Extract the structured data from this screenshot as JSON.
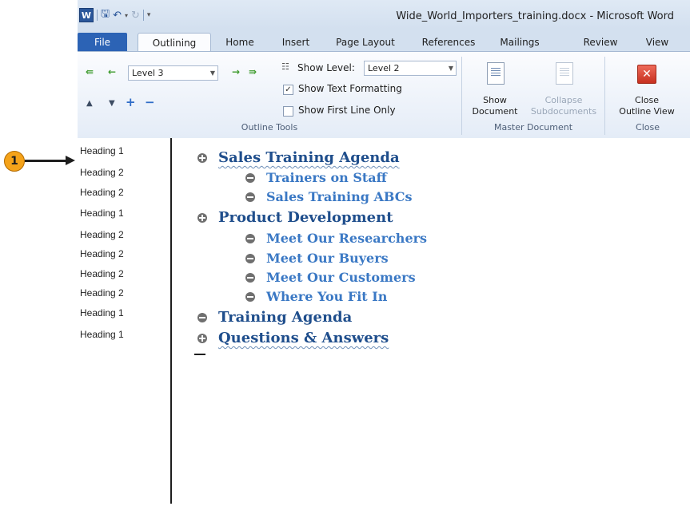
{
  "window": {
    "title": "Wide_World_Importers_training.docx - Microsoft Word",
    "app_icon": "W"
  },
  "quick_access": {
    "icons": [
      "save-icon",
      "undo-icon",
      "redo-icon",
      "customize-icon"
    ]
  },
  "tabs": [
    {
      "label": "File"
    },
    {
      "label": "Outlining"
    },
    {
      "label": "Home"
    },
    {
      "label": "Insert"
    },
    {
      "label": "Page Layout"
    },
    {
      "label": "References"
    },
    {
      "label": "Mailings"
    },
    {
      "label": "Review"
    },
    {
      "label": "View"
    }
  ],
  "ribbon": {
    "outline_tools": {
      "level_value": "Level 3",
      "show_level_label": "Show Level:",
      "show_level_value": "Level 2",
      "show_text_formatting_label": "Show Text Formatting",
      "show_text_formatting_checked": true,
      "show_first_line_only_label": "Show First Line Only",
      "show_first_line_only_checked": false,
      "group_label": "Outline Tools"
    },
    "master_document": {
      "show_document_label_1": "Show",
      "show_document_label_2": "Document",
      "collapse_label_1": "Collapse",
      "collapse_label_2": "Subdocuments",
      "group_label": "Master Document"
    },
    "close": {
      "close_label_1": "Close",
      "close_label_2": "Outline View",
      "group_label": "Close"
    }
  },
  "style_area": [
    "Heading 1",
    "Heading 2",
    "Heading 2",
    "Heading 1",
    "Heading 2",
    "Heading 2",
    "Heading 2",
    "Heading 2",
    "Heading 1",
    "Heading 1"
  ],
  "outline": [
    {
      "text": "Sales Training Agenda",
      "level": 1,
      "symbol": "plus"
    },
    {
      "text": "Trainers on Staff",
      "level": 2,
      "symbol": "minus"
    },
    {
      "text": "Sales Training ABCs",
      "level": 2,
      "symbol": "minus"
    },
    {
      "text": "Product Development",
      "level": 1,
      "symbol": "plus"
    },
    {
      "text": "Meet Our Researchers",
      "level": 2,
      "symbol": "minus"
    },
    {
      "text": "Meet Our Buyers",
      "level": 2,
      "symbol": "minus"
    },
    {
      "text": "Meet Our Customers",
      "level": 2,
      "symbol": "minus"
    },
    {
      "text": "Where You Fit In",
      "level": 2,
      "symbol": "minus"
    },
    {
      "text": "Training Agenda",
      "level": 1,
      "symbol": "minus"
    },
    {
      "text": "Questions & Answers",
      "level": 1,
      "symbol": "plus"
    }
  ],
  "callout": {
    "number": "1"
  },
  "colors": {
    "heading1": "#1f4e8c",
    "heading2": "#3a78c4",
    "file_tab": "#2c63b5",
    "callout": "#f5a31a"
  }
}
